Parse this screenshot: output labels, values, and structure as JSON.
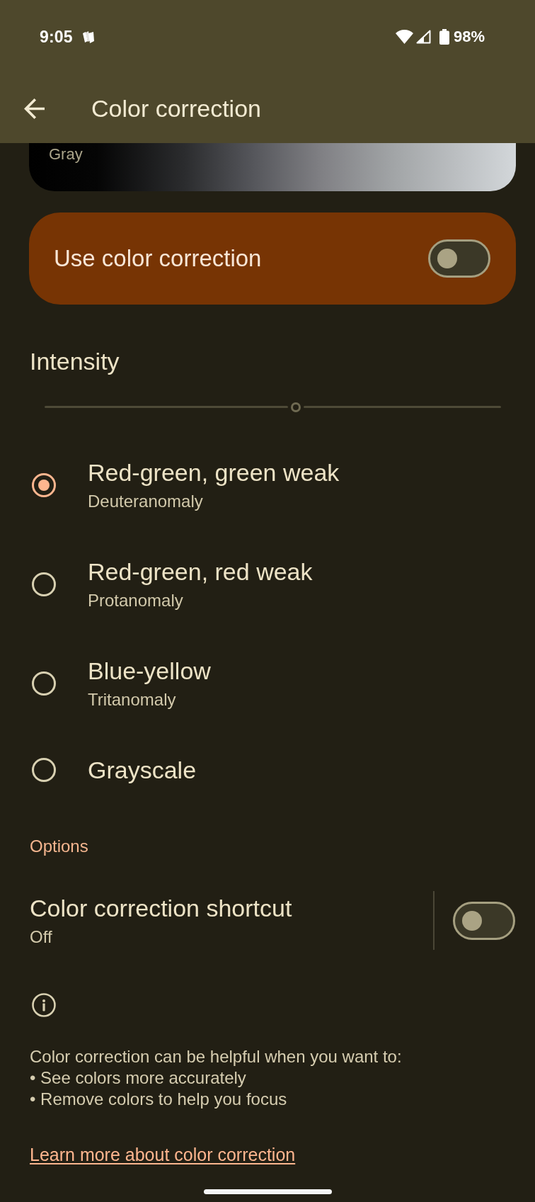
{
  "status_bar": {
    "time": "9:05",
    "battery": "98%"
  },
  "app_bar": {
    "title": "Color correction"
  },
  "preview": {
    "label": "Gray"
  },
  "main_switch": {
    "label": "Use color correction",
    "on": false
  },
  "intensity": {
    "label": "Intensity",
    "level": 0.55
  },
  "modes": [
    {
      "title": "Red-green, green weak",
      "subtitle": "Deuteranomaly",
      "selected": true
    },
    {
      "title": "Red-green, red weak",
      "subtitle": "Protanomaly",
      "selected": false
    },
    {
      "title": "Blue-yellow",
      "subtitle": "Tritanomaly",
      "selected": false
    },
    {
      "title": "Grayscale",
      "selected": false
    }
  ],
  "options": {
    "heading": "Options",
    "shortcut": {
      "title": "Color correction shortcut",
      "subtitle": "Off",
      "on": false
    }
  },
  "info": {
    "text": "Color correction can be helpful when you want to:\n• See colors more accurately\n• Remove colors to help you focus",
    "link": "Learn more about color correction"
  }
}
